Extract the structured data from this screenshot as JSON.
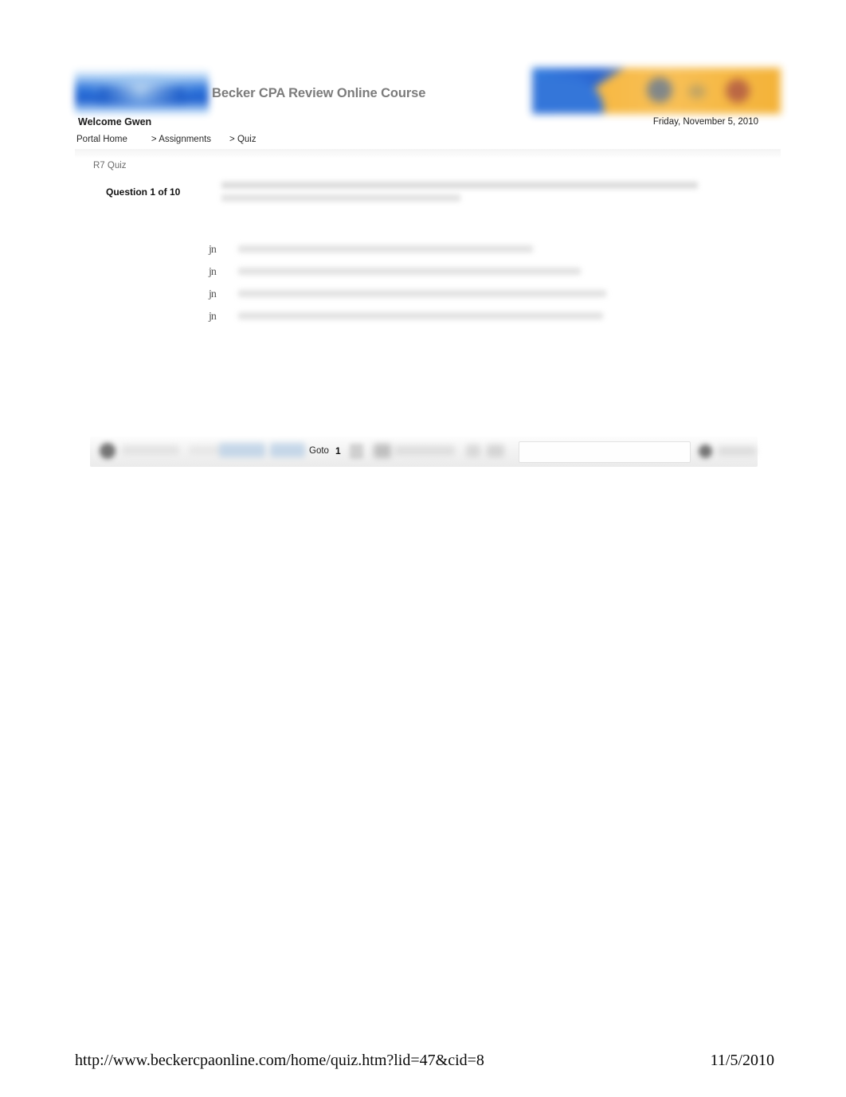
{
  "header": {
    "app_title": "Becker CPA Review Online Course",
    "logo_alt": "becker-logo",
    "welcome": "Welcome Gwen",
    "date": "Friday, November 5, 2010",
    "banner_alt": "course-banner",
    "colors": {
      "banner_orange": "#f6b43a",
      "banner_blue": "#2a6fd8",
      "logo_blue": "#1f5fd0",
      "title_grey": "#7c7c7c"
    }
  },
  "breadcrumb": {
    "items": [
      {
        "label": "Portal Home"
      },
      {
        "label": "> Assignments"
      },
      {
        "label": "> Quiz"
      }
    ]
  },
  "quiz": {
    "title": "R7 Quiz",
    "question_counter": "Question 1 of 10",
    "question_text": "",
    "options": [
      {
        "marker": "j",
        "marker_sub": "n",
        "text": ""
      },
      {
        "marker": "j",
        "marker_sub": "n",
        "text": ""
      },
      {
        "marker": "j",
        "marker_sub": "n",
        "text": ""
      },
      {
        "marker": "j",
        "marker_sub": "n",
        "text": ""
      }
    ]
  },
  "toolbar": {
    "goto_label": "Goto",
    "goto_value": "1",
    "caret_icon": "chevron-down-icon",
    "left_icon": "bullet-icon",
    "submit_icon": "submit-icon"
  },
  "footer": {
    "url": "http://www.beckercpaonline.com/home/quiz.htm?lid=47&cid=8",
    "date": "11/5/2010"
  }
}
